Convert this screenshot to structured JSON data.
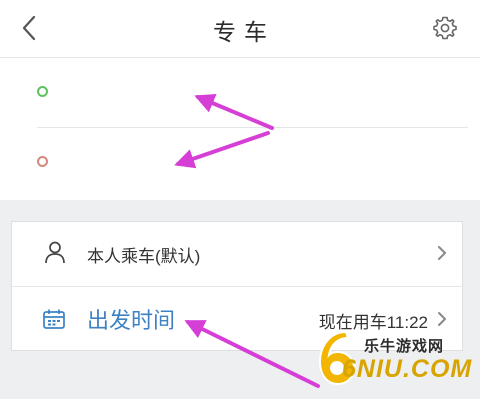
{
  "header": {
    "title": "专车",
    "back_icon": "chevron-left-icon",
    "settings_icon": "gear-icon"
  },
  "route": {
    "start": {
      "value": "",
      "dot_color": "#5cc25d"
    },
    "end": {
      "value": "",
      "dot_color": "#d4887e"
    }
  },
  "options": {
    "passenger": {
      "icon": "person-icon",
      "label": "本人乘车(默认)"
    },
    "departure": {
      "icon": "calendar-icon",
      "label": "出发时间",
      "value": "现在用车11:22"
    }
  },
  "watermark": {
    "text": "乐牛游戏网",
    "domain": "6NIU.COM"
  },
  "colors": {
    "accent": "#3e82c4",
    "annotation_arrow": "#d63fd6",
    "page_background": "#eeeff1"
  }
}
